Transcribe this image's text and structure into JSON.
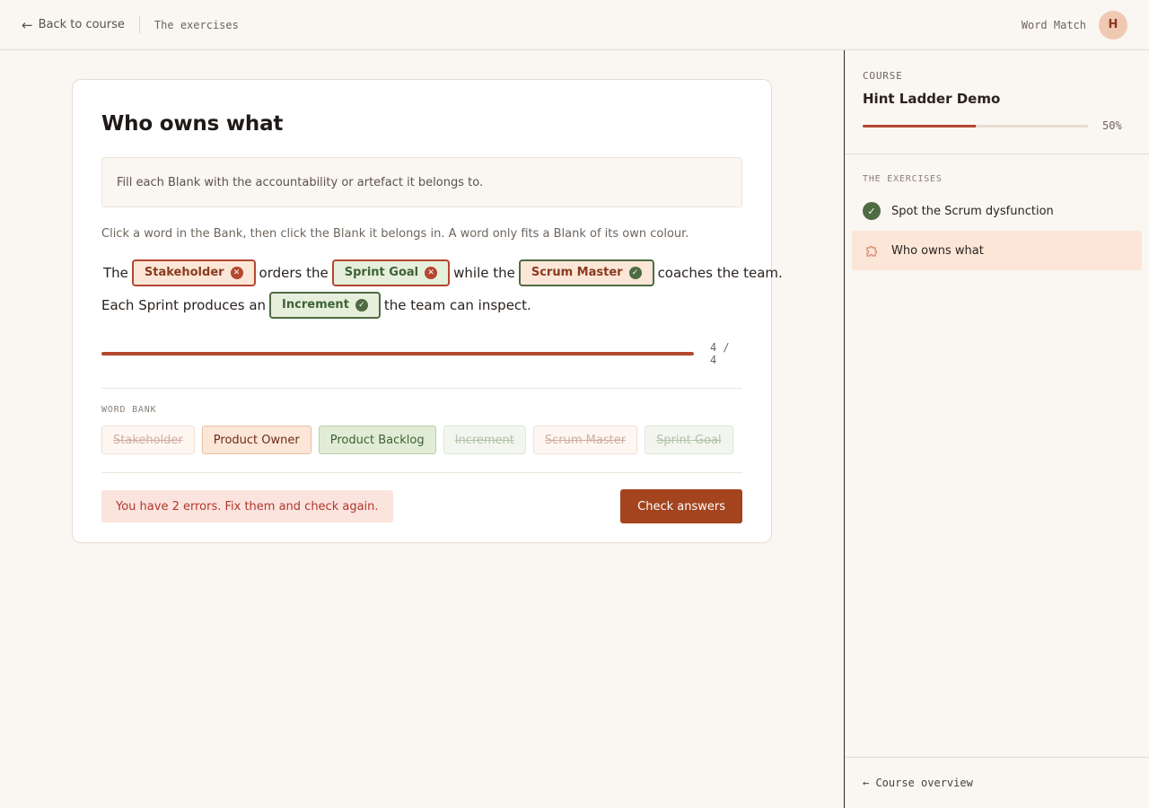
{
  "topbar": {
    "back_arrow": "←",
    "back_label": "Back to course",
    "breadcrumb": "The exercises",
    "mode": "Word Match",
    "avatar_initial": "H"
  },
  "exercise": {
    "title": "Who owns what",
    "prompt": "Fill each Blank with the accountability or artefact it belongs to.",
    "instructions": "Click a word in the Bank, then click the Blank it belongs in. A word only fits a Blank of its own colour.",
    "sentence": {
      "line1": {
        "w1": "The",
        "blank1": {
          "text": "Stakeholder",
          "colour": "orange",
          "status": "wrong",
          "icon": "x-circle-icon"
        },
        "w2": "orders the",
        "blank2": {
          "text": "Sprint Goal",
          "colour": "green",
          "status": "wrong",
          "icon": "x-circle-icon"
        },
        "w3": "while the",
        "blank3": {
          "text": "Scrum Master",
          "colour": "orange",
          "status": "correct",
          "icon": "check-circle-icon"
        },
        "w4": "coaches the team."
      },
      "line2": {
        "w1": "Each Sprint produces an",
        "blank1": {
          "text": "Increment",
          "colour": "green",
          "status": "correct",
          "icon": "check-circle-icon"
        },
        "w2": "the team can inspect."
      }
    },
    "progress": {
      "filled": 4,
      "total": 4,
      "label": "4 / 4",
      "fraction": 1.0
    },
    "bank": {
      "label": "WORD BANK",
      "chips": [
        {
          "text": "Stakeholder",
          "colour": "orange",
          "used": true
        },
        {
          "text": "Product Owner",
          "colour": "orange",
          "used": false
        },
        {
          "text": "Product Backlog",
          "colour": "green",
          "used": false
        },
        {
          "text": "Increment",
          "colour": "green",
          "used": true
        },
        {
          "text": "Scrum Master",
          "colour": "orange",
          "used": true
        },
        {
          "text": "Sprint Goal",
          "colour": "green",
          "used": true
        }
      ]
    },
    "error_message": "You have 2 errors. Fix them and check again.",
    "check_button": "Check answers"
  },
  "sidebar": {
    "course_label": "COURSE",
    "course_name": "Hint Ladder Demo",
    "course_progress": 0.5,
    "course_progress_label": "50%",
    "exercises_label": "THE EXERCISES",
    "exercises": [
      {
        "label": "Spot the Scrum dysfunction",
        "state": "done",
        "icon": "check-circle-icon"
      },
      {
        "label": "Who owns what",
        "state": "active",
        "icon": "puzzle-icon"
      }
    ],
    "footer_link": "← Course overview"
  },
  "colors": {
    "accent": "#a3441f",
    "error": "#b44730",
    "success": "#4f6b43",
    "orange_blank_bg": "#fbe6d8",
    "green_blank_bg": "#e5efdc",
    "background": "#faf6f1"
  }
}
